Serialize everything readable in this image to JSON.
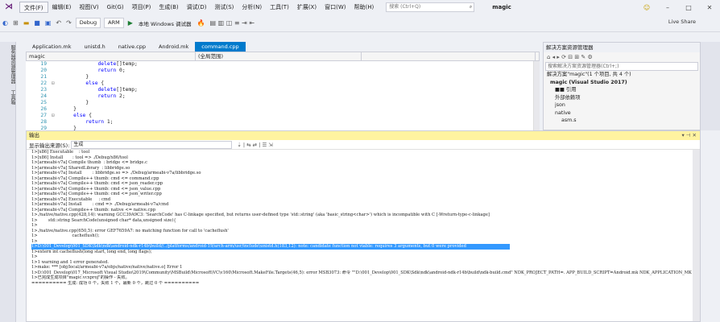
{
  "window": {
    "solution": "magic"
  },
  "menus": [
    "文件(F)",
    "编辑(E)",
    "视图(V)",
    "Git(G)",
    "项目(P)",
    "生成(B)",
    "调试(D)",
    "测试(S)",
    "分析(N)",
    "工具(T)",
    "扩展(X)",
    "窗口(W)",
    "帮助(H)"
  ],
  "search": {
    "placeholder": "搜索 (Ctrl+Q)"
  },
  "toolbar": {
    "config": "Debug",
    "platform": "ARM",
    "debugger": "本地 Windows 调试器",
    "live_share": "Live Share"
  },
  "left_tabs": [
    "服务器资源管理器",
    "工具箱"
  ],
  "editor": {
    "tabs": [
      "Application.mk",
      "unistd.h",
      "native.cpp",
      "Android.mk",
      "command.cpp"
    ],
    "project_dd": "magic",
    "scope_dd": "(全局范围)"
  },
  "code": [
    {
      "n": "19",
      "f": "",
      "t": "            delete[]temp;"
    },
    {
      "n": "20",
      "f": "",
      "t": "            return 0;"
    },
    {
      "n": "21",
      "f": "",
      "t": "        }"
    },
    {
      "n": "22",
      "f": "⊟",
      "t": "        else {"
    },
    {
      "n": "23",
      "f": "",
      "t": "            delete[]temp;"
    },
    {
      "n": "24",
      "f": "",
      "t": "            return 2;"
    },
    {
      "n": "25",
      "f": "",
      "t": "        }"
    },
    {
      "n": "26",
      "f": "",
      "t": "    }"
    },
    {
      "n": "27",
      "f": "⊟",
      "t": "    else {"
    },
    {
      "n": "28",
      "f": "",
      "t": "        return 1;"
    },
    {
      "n": "29",
      "f": "",
      "t": "    }"
    }
  ],
  "solution_explorer": {
    "title": "解决方案资源管理器",
    "search_placeholder": "搜索解决方案资源管理器(Ctrl+;)",
    "items": [
      "解决方案\"magic\"(1 个项目, 共 4 个)",
      "magic (Visual Studio 2017)",
      "■■ 引用",
      "外部依赖项",
      "json",
      "native",
      "asm.s"
    ]
  },
  "output": {
    "title": "输出",
    "source_label": "显示输出来源(S):",
    "source_value": "生成",
    "lines": [
      "1>[x86] Executable    : tool",
      "1>[x86] Install       : tool => ./Debug/x86/tool",
      "1>[armeabi-v7a] Compile thumb  : bridge <= bridge.c",
      "1>[armeabi-v7a] SharedLibrary  : libbridge.so",
      "1>[armeabi-v7a] Install        : libbridge.so => ./Debug/armeabi-v7a/libbridge.so",
      "1>[armeabi-v7a] Compile++ thumb: cmd <= command.cpp",
      "1>[armeabi-v7a] Compile++ thumb: cmd <= json_reader.cpp",
      "1>[armeabi-v7a] Compile++ thumb: cmd <= json_value.cpp",
      "1>[armeabi-v7a] Compile++ thumb: cmd <= json_writer.cpp",
      "1>[armeabi-v7a] Executable     : cmd",
      "1>[armeabi-v7a] Install        : cmd => ./Debug/armeabi-v7a/cmd",
      "1>[armeabi-v7a] Compile++ thumb: native <= native.cpp",
      "1>./native/native.cpp(428,14): warning GCC39A9C3: 'SearchCode' has C-linkage specified, but returns user-defined type 'std::string' (aka 'basic_string<char>') which is incompatible with C [-Wreturn-type-c-linkage]",
      "1>        std::string SearchCode(unsigned char* data,unsigned size){",
      "1>",
      "1>./native/native.cpp(650,5): error GEF7659A7: no matching function for call to 'cacheflush'",
      "1>                          cacheflush();",
      "1>",
      "1>D:\\001_Develop\\001_SDK\\Sdk\\ndk\\android-ndk-r14b\\build//../platforms/android-19/arch-arm/usr/include\\unistd.h(183,12): note: candidate function not viable: requires 3 arguments, but 0 were provided",
      "1>extern int cacheflush(long start, long end, long flags);",
      "1>",
      "1>1 warning and 1 error generated.",
      "1>make: *** [obj/local/armeabi-v7a/objs/native/native/native.o] Error 1",
      "1>D:\\001_Develop\\017_Microsoft Visual Studio\\2019\\Community\\MSBuild\\Microsoft\\VC\\v160\\Microsoft.MakeFile.Targets(46,5): error MSB3073: 命令 \"\"D:\\001_Develop\\001_SDK\\Sdk\\ndk\\android-ndk-r14b\\build\\ndk-build.cmd\" NDK_PROJECT_PATH=. APP_BUILD_SCRIPT=Android.mk NDK_APPLICATION_MK",
      "1>已完成生成项目\"magic.vcxproj\"的操作 - 失败。",
      "========== 生成: 成功 0 个，失败 1 个，最新 0 个，跳过 0 个 =========="
    ],
    "selected_line": 18
  }
}
